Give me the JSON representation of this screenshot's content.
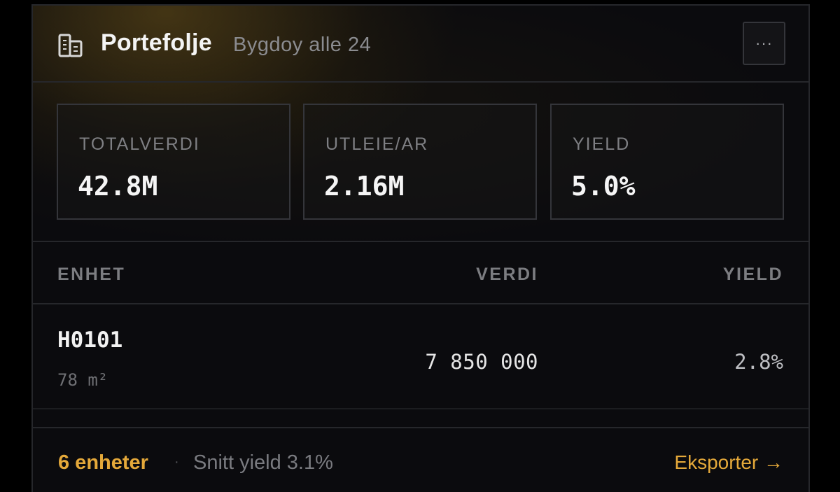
{
  "header": {
    "title": "Portefolje",
    "subtitle": "Bygdoy alle 24",
    "more_label": "···",
    "icon": "building-icon"
  },
  "stats": [
    {
      "label": "TOTALVERDI",
      "value": "42.8M"
    },
    {
      "label": "UTLEIE/AR",
      "value": "2.16M"
    },
    {
      "label": "YIELD",
      "value": "5.0%"
    }
  ],
  "table": {
    "columns": [
      "ENHET",
      "VERDI",
      "YIELD"
    ],
    "rows": [
      {
        "id": "H0101",
        "area": "78 m²",
        "value": "7 850 000",
        "yield": "2.8%"
      }
    ]
  },
  "footer": {
    "count": "6 enheter",
    "separator": "·",
    "average": "Snitt yield 3.1%",
    "export_label": "Eksporter →"
  },
  "colors": {
    "accent": "#e5a93a",
    "background": "#0b0b0e",
    "border": "#26272b"
  }
}
